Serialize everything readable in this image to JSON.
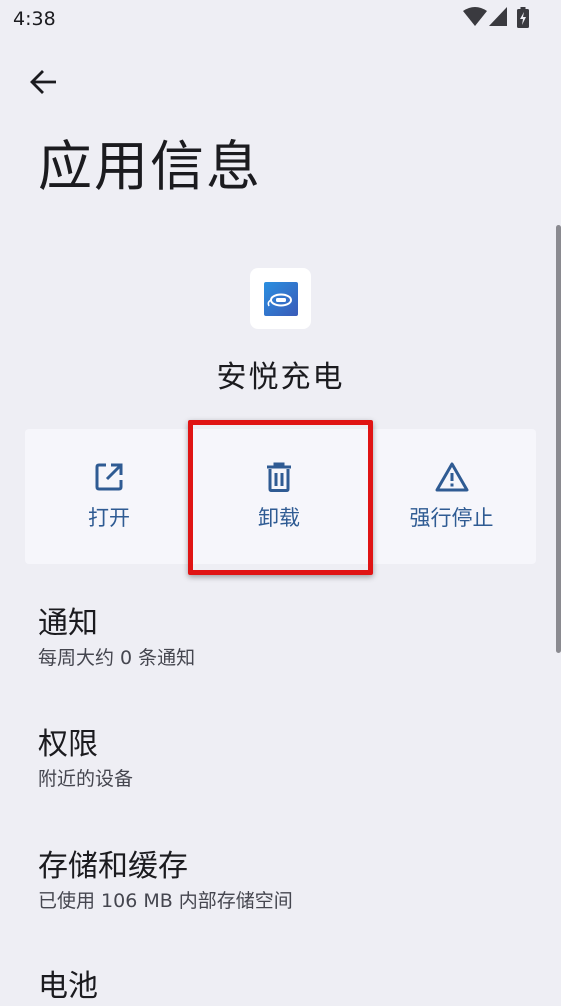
{
  "status_bar": {
    "time": "4:38",
    "icons": [
      "wifi-icon",
      "cell-signal-icon",
      "battery-charging-icon"
    ]
  },
  "header": {
    "back_icon": "arrow-back-icon",
    "title": "应用信息"
  },
  "app": {
    "icon": "ev-charging-app-icon",
    "name": "安悦充电"
  },
  "actions": [
    {
      "id": "open",
      "icon": "open-in-new-icon",
      "label": "打开"
    },
    {
      "id": "uninstall",
      "icon": "trash-icon",
      "label": "卸载"
    },
    {
      "id": "force_stop",
      "icon": "warning-icon",
      "label": "强行停止"
    }
  ],
  "settings": [
    {
      "title": "通知",
      "subtitle": "每周大约 0 条通知"
    },
    {
      "title": "权限",
      "subtitle": "附近的设备"
    },
    {
      "title": "存储和缓存",
      "subtitle": "已使用 106 MB 内部存储空间"
    },
    {
      "title": "电池",
      "subtitle": ""
    }
  ],
  "colors": {
    "background": "#eeeef4",
    "action_panel": "#f6f6fb",
    "accent": "#2f5b93",
    "highlight": "#e01414"
  }
}
